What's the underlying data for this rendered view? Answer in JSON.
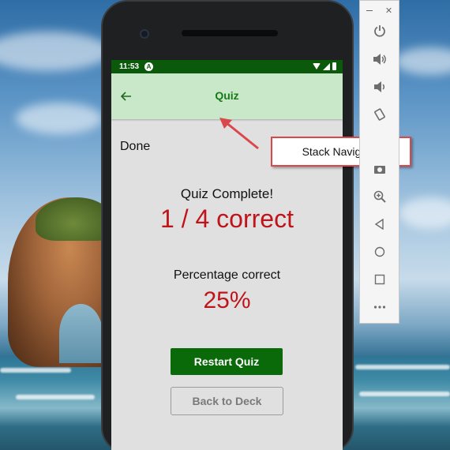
{
  "status_bar": {
    "time": "11:53",
    "badge": "A"
  },
  "header": {
    "title": "Quiz",
    "back_icon": "arrow-back-icon"
  },
  "quiz": {
    "done_label": "Done",
    "complete_label": "Quiz Complete!",
    "score_text": "1 / 4 correct",
    "percentage_label": "Percentage correct",
    "percentage_value": "25%"
  },
  "buttons": {
    "restart_label": "Restart Quiz",
    "back_label": "Back to Deck"
  },
  "callout": {
    "text": "Stack Navigator"
  },
  "emulator_toolbar": {
    "window_controls": [
      "minimize-icon",
      "close-icon"
    ],
    "tools": [
      "power-icon",
      "volume-up-icon",
      "volume-down-icon",
      "rotate-icon",
      "camera-icon",
      "zoom-icon",
      "back-triangle-icon",
      "home-circle-icon",
      "overview-square-icon",
      "more-icon"
    ]
  },
  "colors": {
    "status_bar": "#0b5a0b",
    "header_bg": "#c9e8c9",
    "header_title": "#167a16",
    "score_red": "#c0141b",
    "restart_button": "#0a6a0a",
    "callout_border": "#d9484b"
  }
}
